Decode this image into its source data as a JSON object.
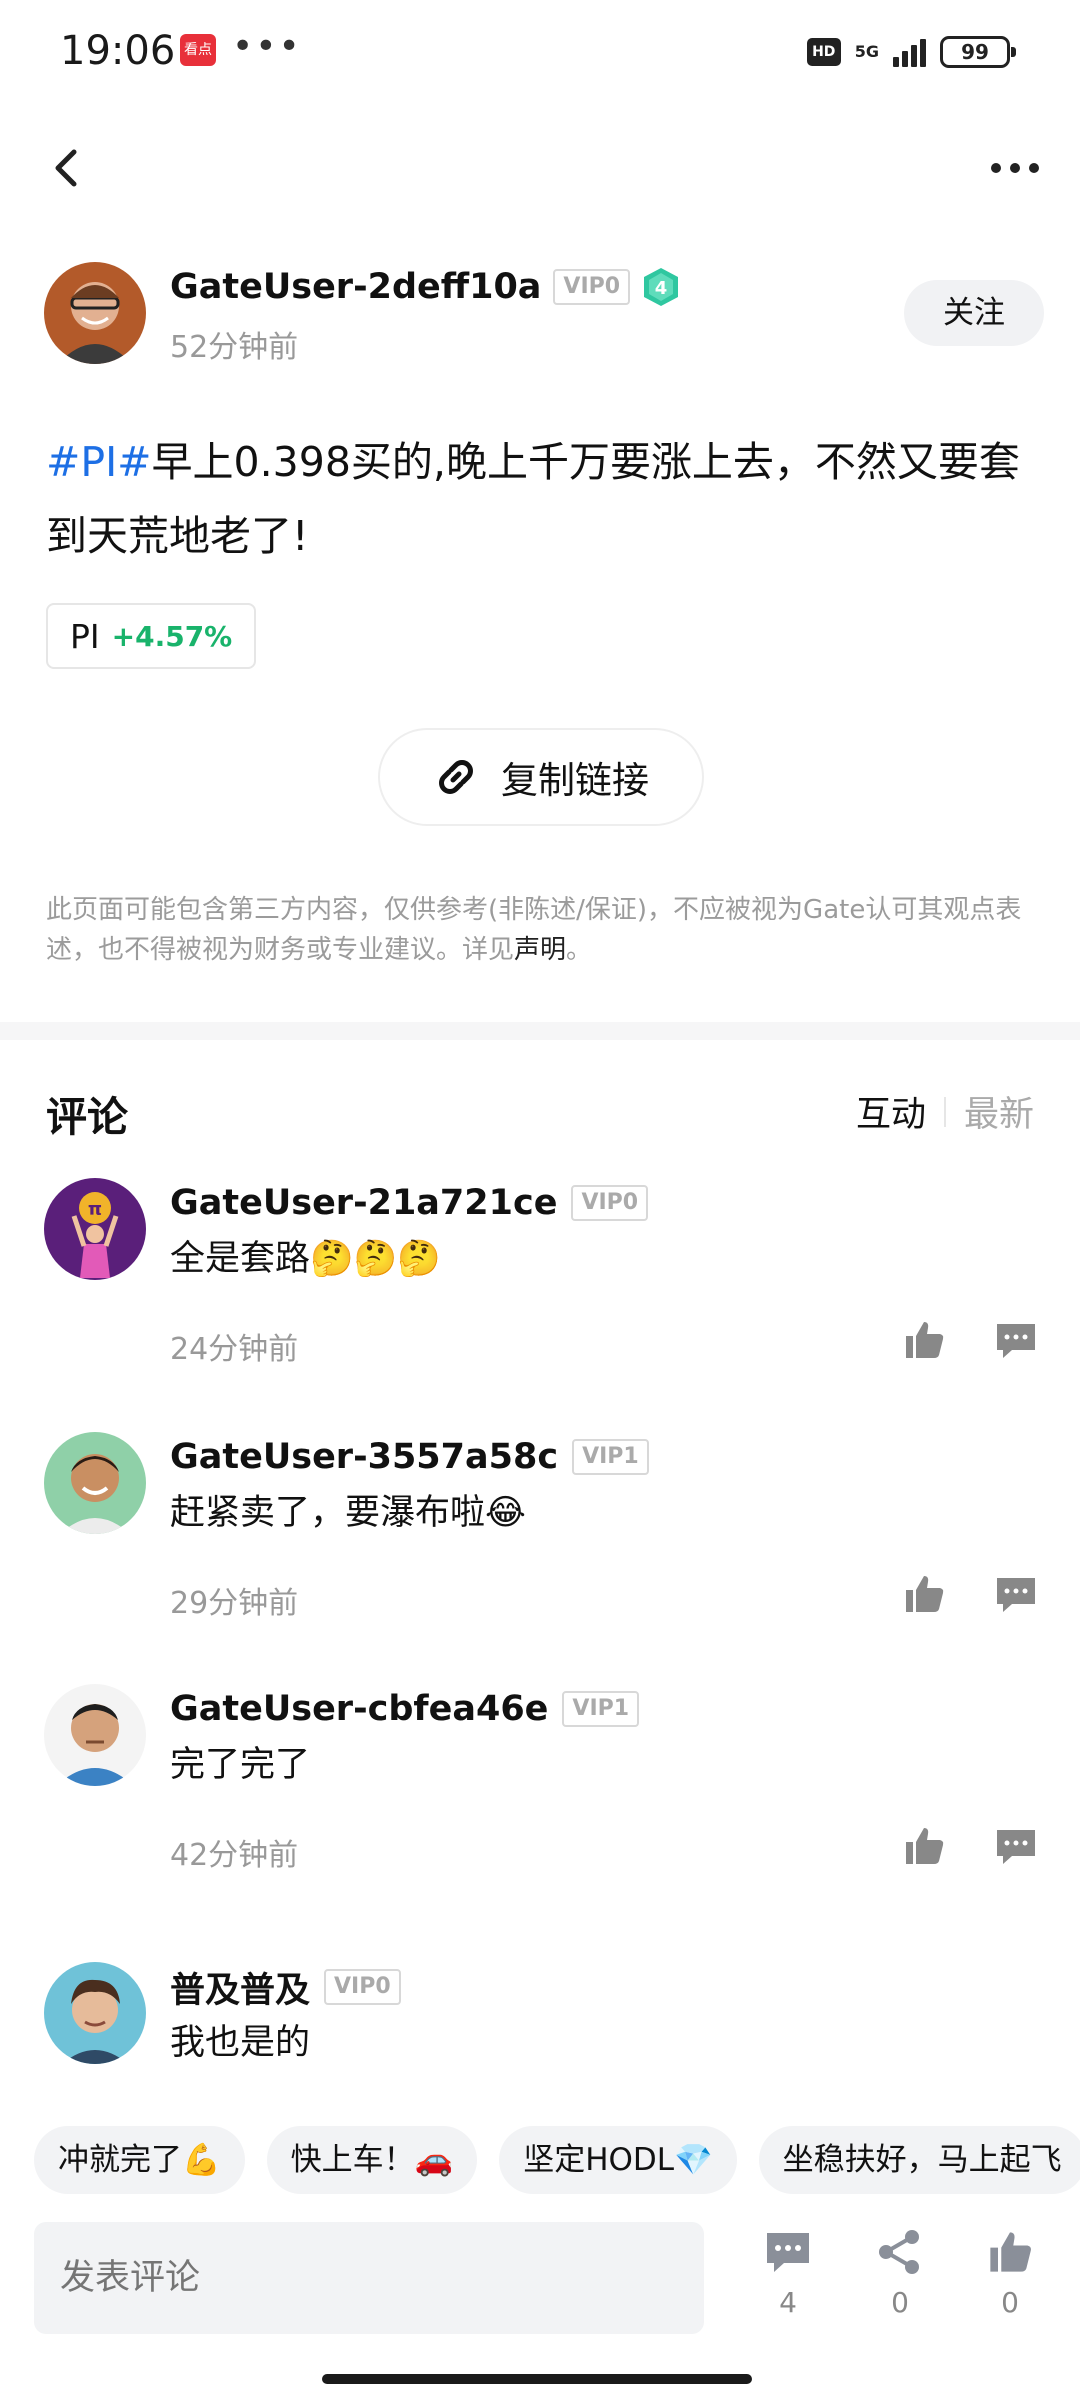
{
  "status_bar": {
    "time": "19:06",
    "app_icon_text": "看点",
    "network": "5G",
    "battery": "99"
  },
  "author": {
    "name": "GateUser-2deff10a",
    "vip": "VIP0",
    "level": "4",
    "time": "52分钟前",
    "follow_label": "关注"
  },
  "post": {
    "hashtag": "#PI#",
    "text": "早上0.398买的,晚上千万要涨上去，不然又要套到天荒地老了!"
  },
  "coin": {
    "name": "PI",
    "change": "+4.57%",
    "change_color": "#19b36b"
  },
  "copy_link_label": "复制链接",
  "disclaimer": {
    "text": "此页面可能包含第三方内容，仅供参考(非陈述/保证)，不应被视为Gate认可其观点表述，也不得被视为财务或专业建议。详见",
    "link": "声明",
    "end": "。"
  },
  "comments_section": {
    "title": "评论",
    "sort_active": "互动",
    "sort_other": "最新"
  },
  "comments": [
    {
      "name": "GateUser-21a721ce",
      "vip": "VIP0",
      "text": "全是套路🤔🤔🤔",
      "time": "24分钟前"
    },
    {
      "name": "GateUser-3557a58c",
      "vip": "VIP1",
      "text": "赶紧卖了，要瀑布啦😂",
      "time": "29分钟前"
    },
    {
      "name": "GateUser-cbfea46e",
      "vip": "VIP1",
      "text": "完了完了",
      "time": "42分钟前"
    },
    {
      "name": "普及普及",
      "vip": "VIP0",
      "text": "我也是的",
      "time": ""
    }
  ],
  "quick_replies": [
    "冲就完了💪",
    "快上车！🚗",
    "坚定HODL💎",
    "坐稳扶好，马上起飞"
  ],
  "bottom_bar": {
    "input_placeholder": "发表评论",
    "comment_count": "4",
    "share_count": "0",
    "like_count": "0"
  },
  "colors": {
    "accent_link": "#1d6fe5",
    "positive": "#19b36b",
    "level_badge": "#2fc7a0"
  }
}
